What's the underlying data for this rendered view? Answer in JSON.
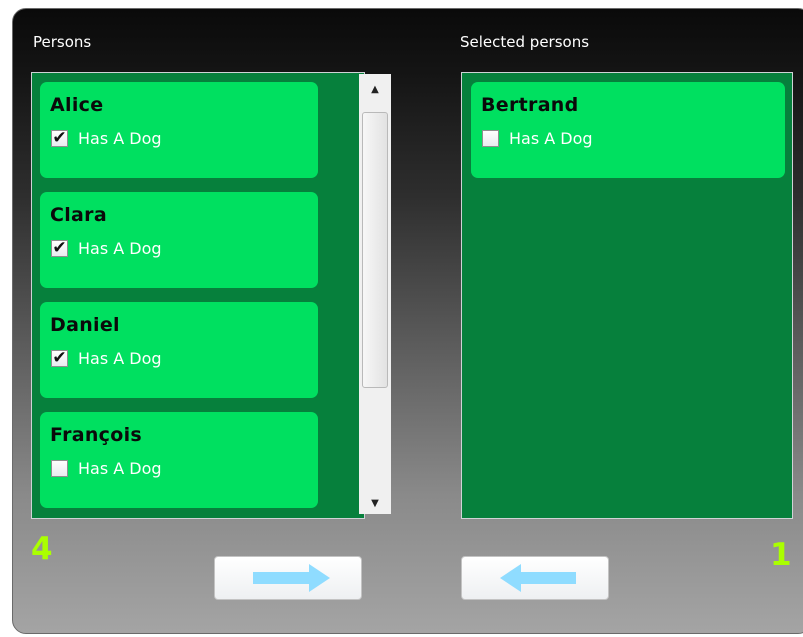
{
  "left_panel": {
    "title": "Persons",
    "count": "4",
    "persons": [
      {
        "name": "Alice",
        "checkbox_label": "Has A Dog",
        "checked": true
      },
      {
        "name": "Clara",
        "checkbox_label": "Has A Dog",
        "checked": true
      },
      {
        "name": "Daniel",
        "checkbox_label": "Has A Dog",
        "checked": true
      },
      {
        "name": "François",
        "checkbox_label": "Has A Dog",
        "checked": false
      }
    ]
  },
  "right_panel": {
    "title": "Selected persons",
    "count": "1",
    "persons": [
      {
        "name": "Bertrand",
        "checkbox_label": "Has A Dog",
        "checked": false
      }
    ]
  },
  "buttons": {
    "move_right_icon": "arrow-right-icon",
    "move_left_icon": "arrow-left-icon"
  },
  "colors": {
    "window_top": "#0a0a0a",
    "window_bottom": "#a4a4a4",
    "list_background": "#06803c",
    "card_background": "#00e060",
    "count_text": "#aaff00",
    "arrow_fill": "#8fdcff"
  }
}
